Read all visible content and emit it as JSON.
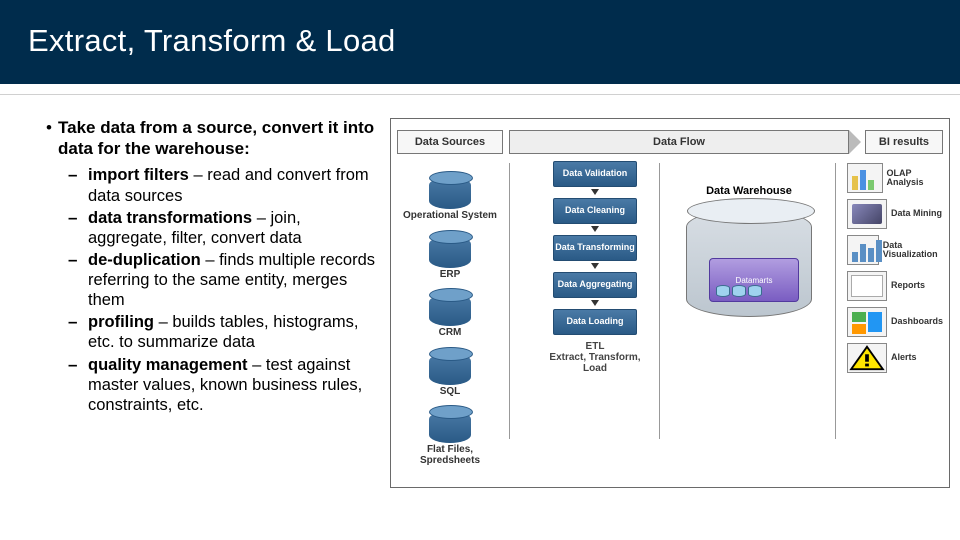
{
  "title": "Extract, Transform & Load",
  "mainBullet": "Take data from a source, convert it into data for the warehouse:",
  "subs": [
    {
      "bold": "import filters",
      "rest": " – read and convert from data sources"
    },
    {
      "bold": "data transformations",
      "rest": " – join, aggregate, filter, convert data"
    },
    {
      "bold": "de-duplication",
      "rest": " – finds multiple records referring to the same entity, merges them"
    },
    {
      "bold": "profiling",
      "rest": " – builds tables, histograms, etc. to summarize data"
    },
    {
      "bold": "quality management",
      "rest": " – test against master values, known business rules, constraints, etc."
    }
  ],
  "diagram": {
    "headers": {
      "ds": "Data Sources",
      "df": "Data Flow",
      "bi": "BI results"
    },
    "sources": [
      "Operational System",
      "ERP",
      "CRM",
      "SQL",
      "Flat Files, Spredsheets"
    ],
    "etlSteps": [
      "Data Validation",
      "Data Cleaning",
      "Data Transforming",
      "Data Aggregating",
      "Data Loading"
    ],
    "etlCaption": "ETL\nExtract, Transform, Load",
    "dw": {
      "label": "Data Warehouse",
      "marts": "Datamarts"
    },
    "bi": [
      "OLAP Analysis",
      "Data Mining",
      "Data Visualization",
      "Reports",
      "Dashboards",
      "Alerts"
    ]
  }
}
